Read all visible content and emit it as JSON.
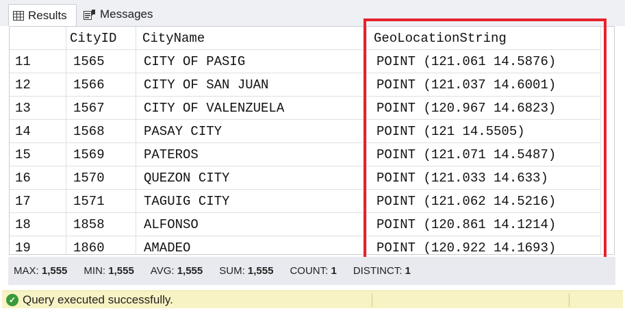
{
  "tabs": {
    "results": "Results",
    "messages": "Messages"
  },
  "grid": {
    "columns": [
      "",
      "CityID",
      "CityName",
      "GeoLocationString"
    ],
    "rows": [
      [
        "11",
        "1565",
        "CITY OF PASIG",
        "POINT (121.061 14.5876)"
      ],
      [
        "12",
        "1566",
        "CITY OF SAN JUAN",
        "POINT (121.037 14.6001)"
      ],
      [
        "13",
        "1567",
        "CITY OF VALENZUELA",
        "POINT (120.967 14.6823)"
      ],
      [
        "14",
        "1568",
        "PASAY CITY",
        "POINT (121 14.5505)"
      ],
      [
        "15",
        "1569",
        "PATEROS",
        "POINT (121.071 14.5487)"
      ],
      [
        "16",
        "1570",
        "QUEZON CITY",
        "POINT (121.033 14.633)"
      ],
      [
        "17",
        "1571",
        "TAGUIG CITY",
        "POINT (121.062 14.5216)"
      ],
      [
        "18",
        "1858",
        "ALFONSO",
        "POINT (120.861 14.1214)"
      ],
      [
        "19",
        "1860",
        "AMADEO",
        "POINT (120.922 14.1693)"
      ]
    ]
  },
  "aggregates": [
    {
      "label": "MAX:",
      "value": "1,555"
    },
    {
      "label": "MIN:",
      "value": "1,555"
    },
    {
      "label": "AVG:",
      "value": "1,555"
    },
    {
      "label": "SUM:",
      "value": "1,555"
    },
    {
      "label": "COUNT:",
      "value": "1"
    },
    {
      "label": "DISTINCT:",
      "value": "1"
    }
  ],
  "status": {
    "message": "Query executed successfully."
  },
  "colors": {
    "highlight": "#e8202a",
    "status_bg": "#f7f3c4",
    "ok_icon": "#3a9a3a"
  }
}
